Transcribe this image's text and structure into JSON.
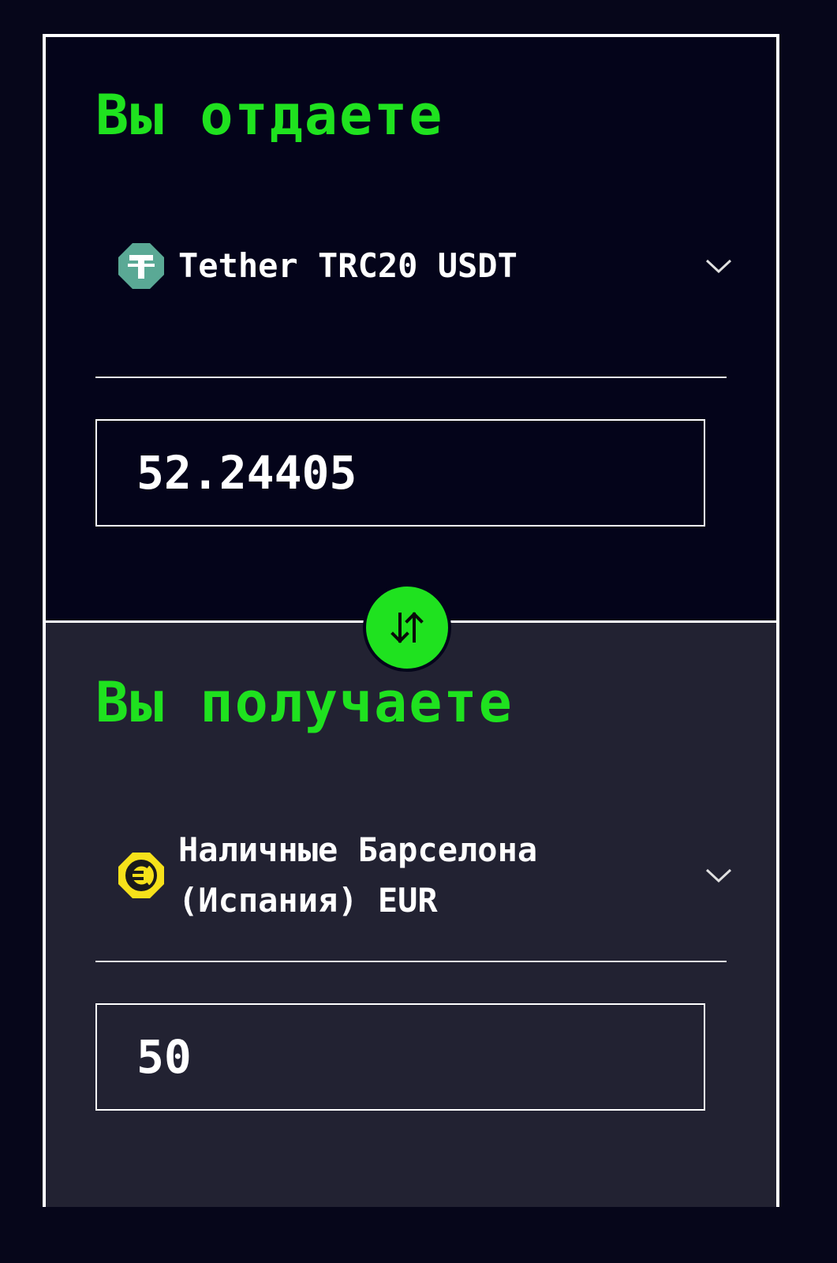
{
  "give": {
    "title": "Вы отдаете",
    "currency": "Tether TRC20 USDT",
    "currency_icon": "tether-icon",
    "amount": "52.24405"
  },
  "get": {
    "title": "Вы получаете",
    "currency": "Наличные Барселона (Испания) EUR",
    "currency_icon": "euro-icon",
    "amount": "50"
  },
  "colors": {
    "accent": "#1fe21f",
    "background_top": "#04041a",
    "background_bottom": "#222232",
    "tether": "#5aa995",
    "euro": "#f6e11a"
  }
}
